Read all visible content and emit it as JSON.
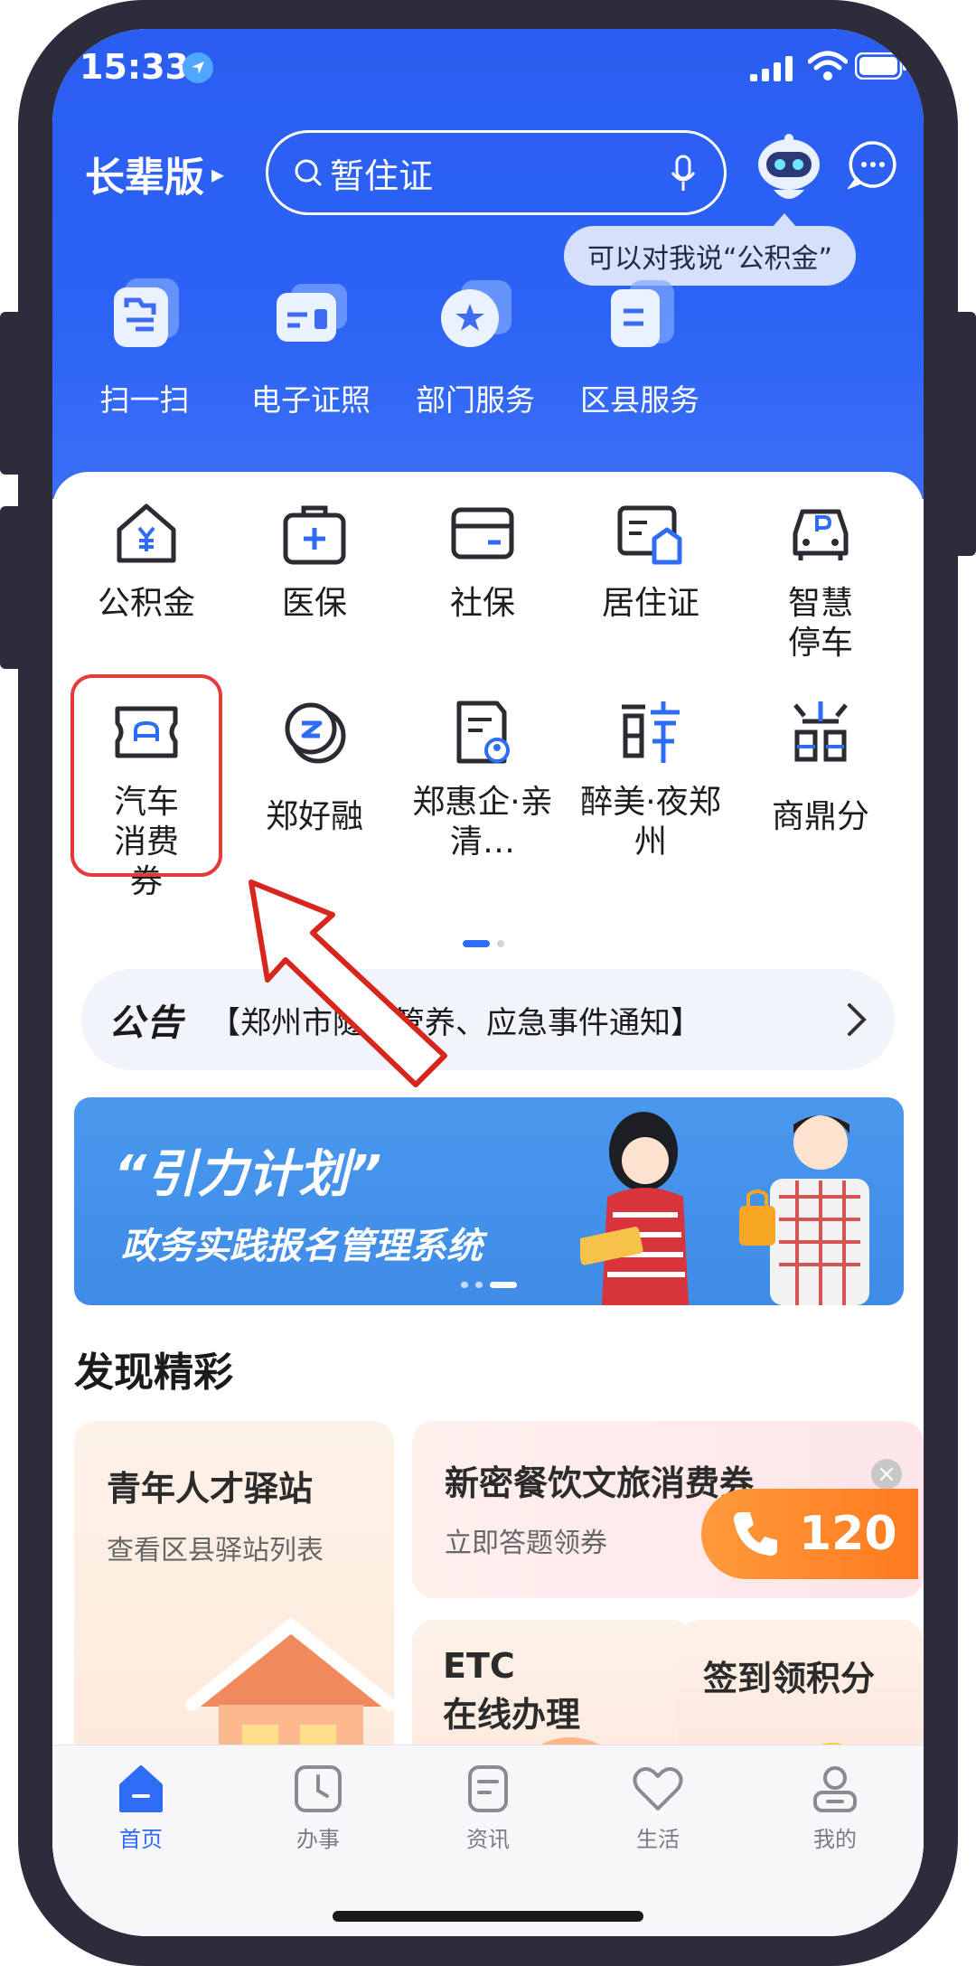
{
  "status_bar": {
    "time": "15:33"
  },
  "header": {
    "mode_label": "长辈版",
    "search": {
      "value": "暂住证"
    },
    "tooltip": "可以对我说“公积金”"
  },
  "quick_actions": [
    {
      "label": "扫一扫",
      "icon": "scan-icon"
    },
    {
      "label": "电子证照",
      "icon": "id-card-icon"
    },
    {
      "label": "部门服务",
      "icon": "department-icon"
    },
    {
      "label": "区县服务",
      "icon": "district-icon"
    }
  ],
  "services": [
    {
      "label": "公积金",
      "icon": "housing-fund-icon"
    },
    {
      "label": "医保",
      "icon": "medical-kit-icon"
    },
    {
      "label": "社保",
      "icon": "social-security-card-icon"
    },
    {
      "label": "居住证",
      "icon": "residence-permit-icon"
    },
    {
      "label": "智慧停车",
      "icon": "parking-car-icon"
    },
    {
      "label": "汽车消费券",
      "icon": "car-coupon-icon"
    },
    {
      "label": "郑好融",
      "icon": "finance-coin-icon"
    },
    {
      "label": "郑惠企·亲清…",
      "icon": "enterprise-doc-icon"
    },
    {
      "label": "醉美·夜郑州",
      "icon": "night-culture-icon"
    },
    {
      "label": "商鼎分",
      "icon": "shangding-icon"
    }
  ],
  "notice": {
    "badge": "公告",
    "text": "【郑州市隧道管养、应急事件通知】"
  },
  "banner": {
    "title": "“引力计划”",
    "subtitle": "政务实践报名管理系统"
  },
  "discover": {
    "title": "发现精彩",
    "cards": [
      {
        "title": "青年人才驿站",
        "subtitle": "查看区县驿站列表"
      },
      {
        "title": "新密餐饮文旅消费券",
        "subtitle": "立即答题领券"
      },
      {
        "title": "ETC\n在线办理",
        "subtitle": ""
      },
      {
        "title": "签到领积分",
        "subtitle": ""
      }
    ]
  },
  "hotline": {
    "number": "120"
  },
  "tab_bar": [
    {
      "label": "首页",
      "icon": "home-icon",
      "active": true
    },
    {
      "label": "办事",
      "icon": "clock-icon",
      "active": false
    },
    {
      "label": "资讯",
      "icon": "news-icon",
      "active": false
    },
    {
      "label": "生活",
      "icon": "heart-icon",
      "active": false
    },
    {
      "label": "我的",
      "icon": "profile-icon",
      "active": false
    }
  ],
  "colors": {
    "primary": "#2c63f4",
    "highlight_red": "#e53a3a",
    "hotline_orange": "#ff8a2a"
  }
}
